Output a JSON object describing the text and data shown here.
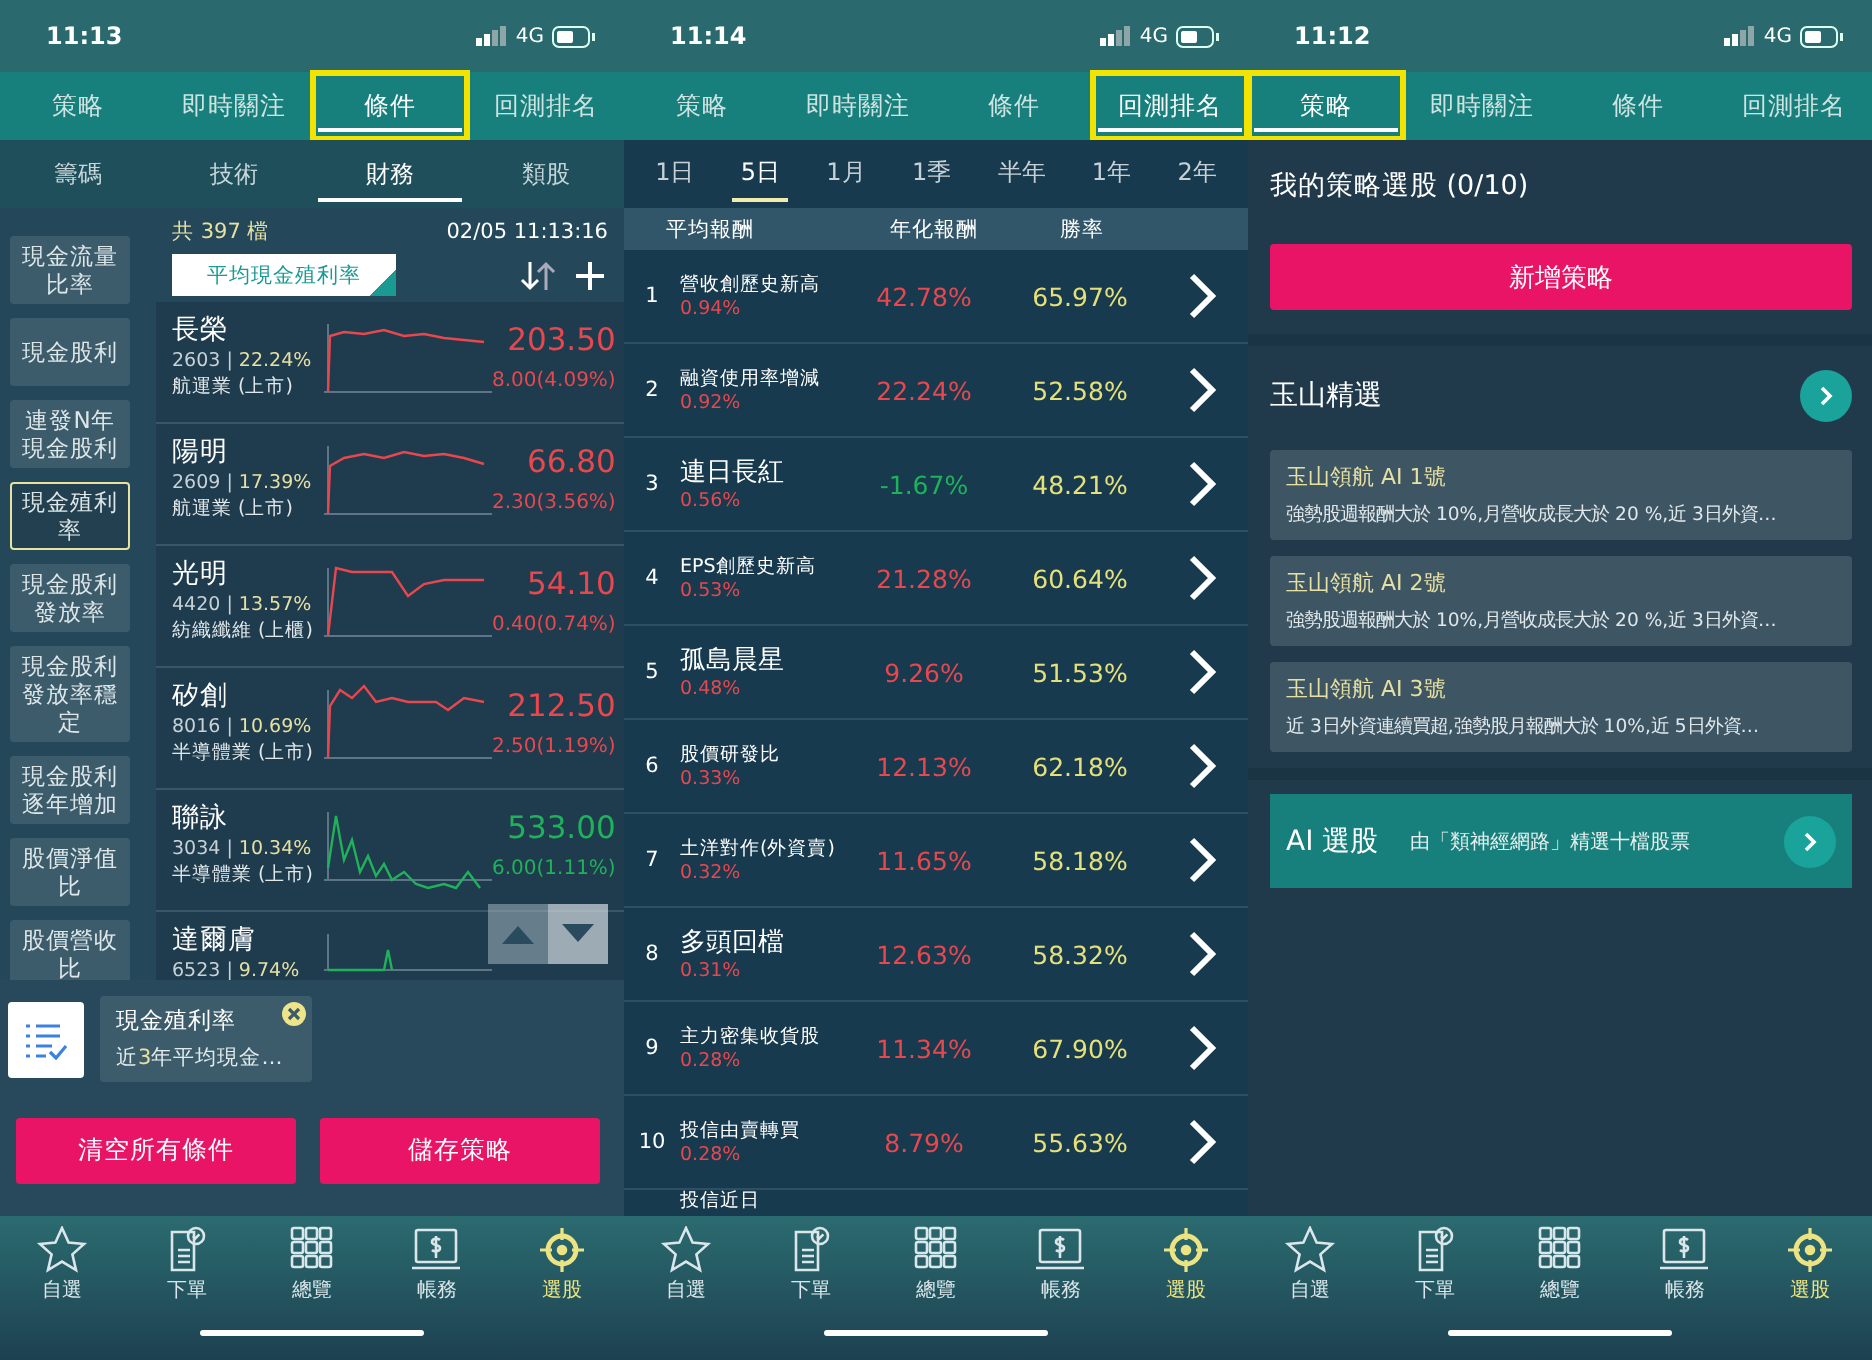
{
  "phones": [
    {
      "kind": "conditions",
      "time": "11:13",
      "network": "4G",
      "tabs": [
        {
          "label": "策略",
          "selected": false,
          "highlighted": false
        },
        {
          "label": "即時關注",
          "selected": false,
          "highlighted": false
        },
        {
          "label": "條件",
          "selected": true,
          "highlighted": true
        },
        {
          "label": "回測排名",
          "selected": false,
          "highlighted": false
        }
      ],
      "subtabs": [
        {
          "label": "籌碼",
          "selected": false
        },
        {
          "label": "技術",
          "selected": false
        },
        {
          "label": "財務",
          "selected": true
        },
        {
          "label": "類股",
          "selected": false
        }
      ],
      "sidebar": [
        {
          "label": "現金流量比率",
          "selected": false
        },
        {
          "label": "現金股利",
          "selected": false
        },
        {
          "label": "連發N年現金股利",
          "selected": false
        },
        {
          "label": "現金殖利率",
          "selected": true
        },
        {
          "label": "現金股利發放率",
          "selected": false
        },
        {
          "label": "現金股利發放率穩定",
          "selected": false
        },
        {
          "label": "現金股利逐年增加",
          "selected": false
        },
        {
          "label": "股價淨值比",
          "selected": false
        },
        {
          "label": "股價營收比",
          "selected": false
        }
      ],
      "count": "共 397 檔",
      "timestamp": "02/05 11:13:16",
      "sort_field": "平均現金殖利率",
      "stocks": [
        {
          "name": "長榮",
          "code": "2603 |",
          "yield": "22.24%",
          "industry": "航運業 (上市)",
          "price": "203.50",
          "change": "8.00(4.09%)",
          "color": "#e8474e"
        },
        {
          "name": "陽明",
          "code": "2609 |",
          "yield": "17.39%",
          "industry": "航運業 (上市)",
          "price": "66.80",
          "change": "2.30(3.56%)",
          "color": "#e8474e"
        },
        {
          "name": "光明",
          "code": "4420 |",
          "yield": "13.57%",
          "industry": "紡織纖維 (上櫃)",
          "price": "54.10",
          "change": "0.40(0.74%)",
          "color": "#e8474e"
        },
        {
          "name": "矽創",
          "code": "8016 |",
          "yield": "10.69%",
          "industry": "半導體業 (上市)",
          "price": "212.50",
          "change": "2.50(1.19%)",
          "color": "#e8474e"
        },
        {
          "name": "聯詠",
          "code": "3034 |",
          "yield": "10.34%",
          "industry": "半導體業 (上市)",
          "price": "533.00",
          "change": "6.00(1.11%)",
          "color": "#1fb25a"
        },
        {
          "name": "達爾膚",
          "code": "6523 |",
          "yield": "9.74%",
          "color": "#1fb25a"
        }
      ],
      "condition": {
        "title": "現金殖利率",
        "description": "近**3**年平均現金…"
      },
      "buttons": [
        "清空所有條件",
        "儲存策略"
      ],
      "nav": [
        {
          "label": "自選",
          "selected": false
        },
        {
          "label": "下單",
          "selected": false
        },
        {
          "label": "總覽",
          "selected": false
        },
        {
          "label": "帳務",
          "selected": false
        },
        {
          "label": "選股",
          "selected": true
        }
      ]
    },
    {
      "kind": "backtest",
      "time": "11:14",
      "network": "4G",
      "tabs": [
        {
          "label": "策略",
          "selected": false,
          "highlighted": false
        },
        {
          "label": "即時關注",
          "selected": false,
          "highlighted": false
        },
        {
          "label": "條件",
          "selected": false,
          "highlighted": false
        },
        {
          "label": "回測排名",
          "selected": true,
          "highlighted": true
        }
      ],
      "periods": [
        {
          "label": "1日",
          "selected": false
        },
        {
          "label": "5日",
          "selected": true
        },
        {
          "label": "1月",
          "selected": false
        },
        {
          "label": "1季",
          "selected": false
        },
        {
          "label": "半年",
          "selected": false
        },
        {
          "label": "1年",
          "selected": false
        },
        {
          "label": "2年",
          "selected": false
        }
      ],
      "columns": [
        "平均報酬",
        "年化報酬",
        "勝率"
      ],
      "rows": [
        {
          "rank": "1",
          "name": "營收創歷史新高",
          "kind": "small",
          "average": "0.94%",
          "annual": "42.78%",
          "color": "#e8474e",
          "win_rate": "65.97%"
        },
        {
          "rank": "2",
          "name": "融資使用率增減",
          "kind": "small",
          "average": "0.92%",
          "annual": "22.24%",
          "color": "#e8474e",
          "win_rate": "52.58%"
        },
        {
          "rank": "3",
          "name": "連日長紅",
          "kind": "big",
          "average": "0.56%",
          "annual": "-1.67%",
          "color": "#1fb25a",
          "win_rate": "48.21%"
        },
        {
          "rank": "4",
          "name": "EPS創歷史新高",
          "kind": "small",
          "average": "0.53%",
          "annual": "21.28%",
          "color": "#e8474e",
          "win_rate": "60.64%"
        },
        {
          "rank": "5",
          "name": "孤島晨星",
          "kind": "big",
          "average": "0.48%",
          "annual": "9.26%",
          "color": "#e8474e",
          "win_rate": "51.53%"
        },
        {
          "rank": "6",
          "name": "股價研發比",
          "kind": "small",
          "average": "0.33%",
          "annual": "12.13%",
          "color": "#e8474e",
          "win_rate": "62.18%"
        },
        {
          "rank": "7",
          "name": "土洋對作(外資賣)",
          "kind": "small",
          "average": "0.32%",
          "annual": "11.65%",
          "color": "#e8474e",
          "win_rate": "58.18%"
        },
        {
          "rank": "8",
          "name": "多頭回檔",
          "kind": "big",
          "average": "0.31%",
          "annual": "12.63%",
          "color": "#e8474e",
          "win_rate": "58.32%"
        },
        {
          "rank": "9",
          "name": "主力密集收貨股",
          "kind": "small",
          "average": "0.28%",
          "annual": "11.34%",
          "color": "#e8474e",
          "win_rate": "67.90%"
        },
        {
          "rank": "10",
          "name": "投信由賣轉買",
          "kind": "small",
          "average": "0.28%",
          "annual": "8.79%",
          "color": "#e8474e",
          "win_rate": "55.63%"
        },
        {
          "name": "投信近日",
          "kind": "small"
        }
      ],
      "nav": [
        {
          "label": "自選",
          "selected": false
        },
        {
          "label": "下單",
          "selected": false
        },
        {
          "label": "總覽",
          "selected": false
        },
        {
          "label": "帳務",
          "selected": false
        },
        {
          "label": "選股",
          "selected": true
        }
      ]
    },
    {
      "kind": "strategy",
      "time": "11:12",
      "network": "4G",
      "tabs": [
        {
          "label": "策略",
          "selected": true,
          "highlighted": true
        },
        {
          "label": "即時關注",
          "selected": false,
          "highlighted": false
        },
        {
          "label": "條件",
          "selected": false,
          "highlighted": false
        },
        {
          "label": "回測排名",
          "selected": false,
          "highlighted": false
        }
      ],
      "heading": "我的策略選股 (0/10)",
      "add_button": "新增策略",
      "section_title": "玉山精選",
      "picks": [
        {
          "title": "玉山領航 AI 1號",
          "description": "強勢股週報酬大於 10%,月營收成長大於 20 %,近 3日外資…"
        },
        {
          "title": "玉山領航 AI 2號",
          "description": "強勢股週報酬大於 10%,月營收成長大於 20 %,近 3日外資…"
        },
        {
          "title": "玉山領航 AI 3號",
          "description": "近 3日外資連續買超,強勢股月報酬大於 10%,近 5日外資…"
        }
      ],
      "ai_banner": {
        "title": "AI 選股",
        "subtitle": "由「類神經網路」精選十檔股票"
      },
      "nav": [
        {
          "label": "自選",
          "selected": false
        },
        {
          "label": "下單",
          "selected": false
        },
        {
          "label": "總覽",
          "selected": false
        },
        {
          "label": "帳務",
          "selected": false
        },
        {
          "label": "選股",
          "selected": true
        }
      ]
    }
  ]
}
